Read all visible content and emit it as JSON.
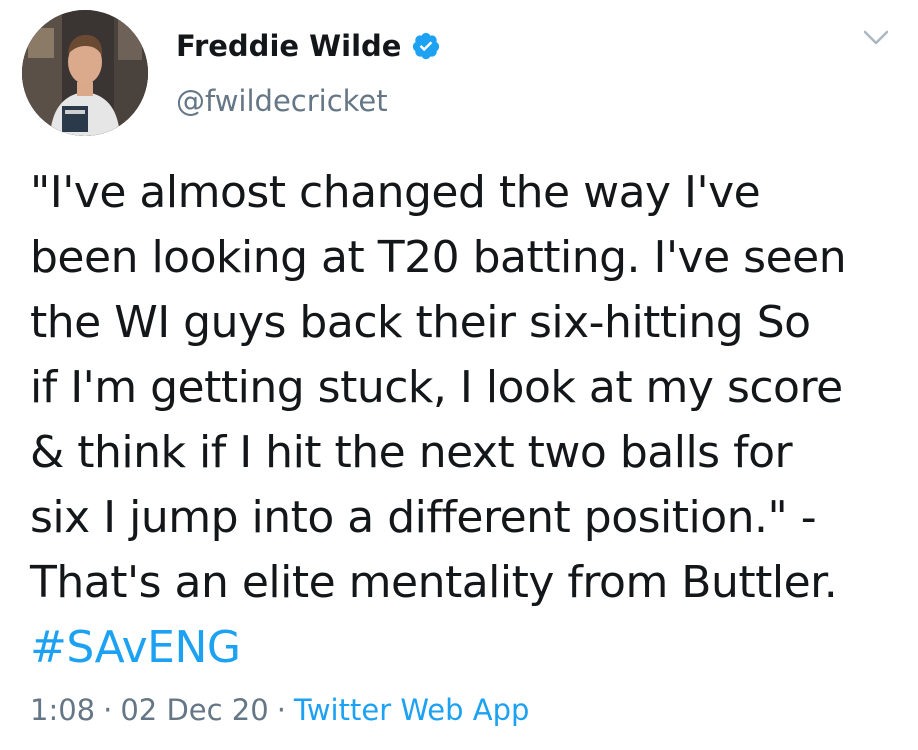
{
  "author": {
    "name": "Freddie Wilde",
    "handle": "@fwildecricket",
    "verified": true
  },
  "tweet": {
    "text": "\"I've almost changed the way I've\nbeen looking at T20 batting. I've seen\nthe WI guys back their six-hitting So\nif I'm getting stuck, I look at my score\n& think if I hit the next two balls for\nsix I jump into a different position.\" -\nThat's an elite mentality from Buttler.",
    "hashtag": "#SAvENG"
  },
  "meta": {
    "time": "1:08",
    "separator": "·",
    "date": "02 Dec 20",
    "source": "Twitter Web App"
  },
  "icons": {
    "verified": "verified-badge-icon",
    "menu": "chevron-down-icon"
  },
  "colors": {
    "link": "#1da1f2",
    "secondary": "#657786",
    "text": "#14171a"
  }
}
